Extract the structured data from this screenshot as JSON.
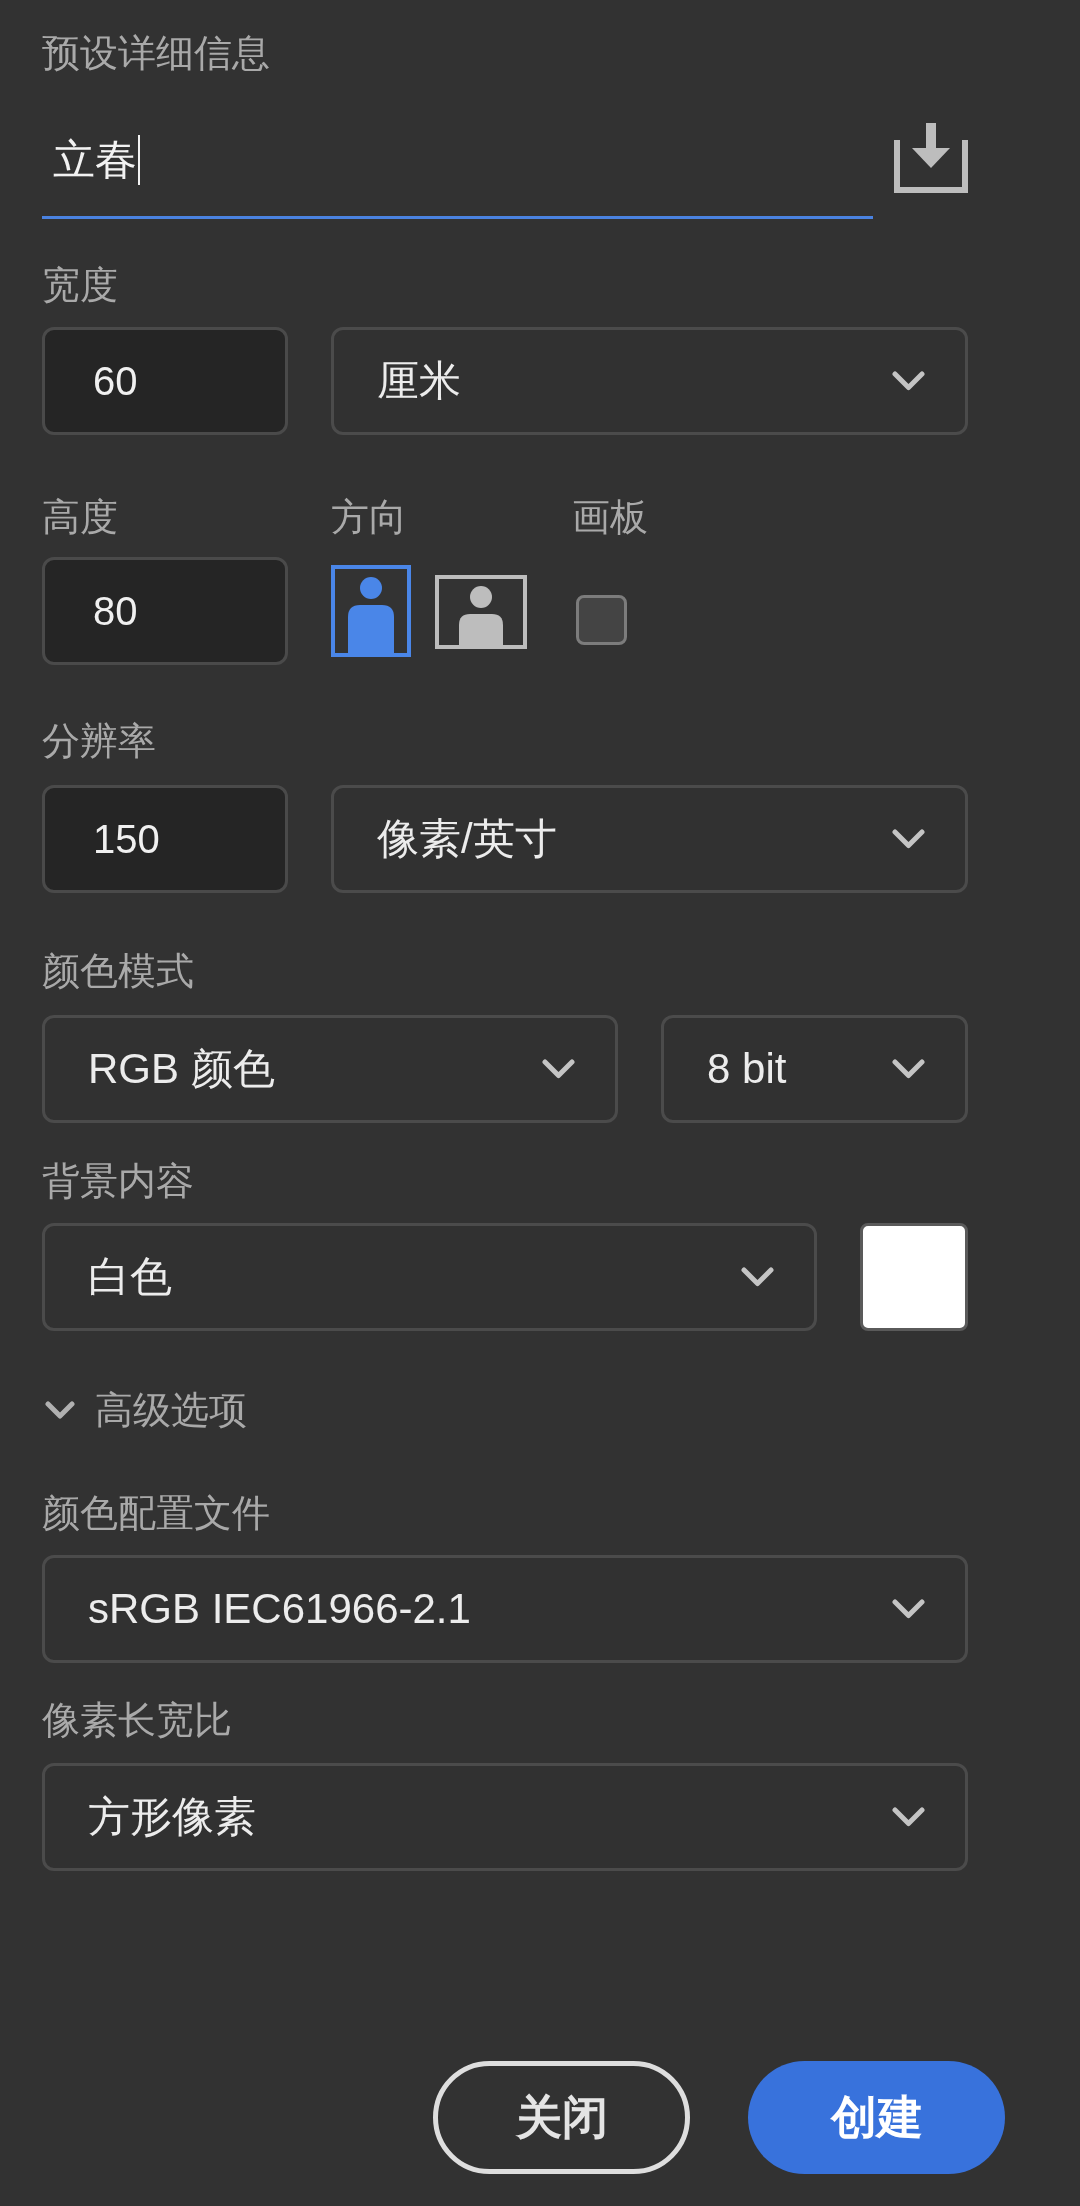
{
  "title": "预设详细信息",
  "preset_name": {
    "value": "立春",
    "focused": true
  },
  "width": {
    "label": "宽度",
    "value": "60",
    "unit": "厘米"
  },
  "height": {
    "label": "高度",
    "value": "80"
  },
  "orientation": {
    "label": "方向",
    "options": [
      {
        "kind": "portrait",
        "selected": true
      },
      {
        "kind": "landscape",
        "selected": false
      }
    ]
  },
  "artboard": {
    "label": "画板",
    "checked": false
  },
  "resolution": {
    "label": "分辨率",
    "value": "150",
    "unit": "像素/英寸"
  },
  "color_mode": {
    "label": "颜色模式",
    "mode": "RGB 颜色",
    "depth": "8 bit"
  },
  "background": {
    "label": "背景内容",
    "value": "白色",
    "color": "#ffffff"
  },
  "advanced": {
    "label": "高级选项",
    "expanded": true,
    "color_profile": {
      "label": "颜色配置文件",
      "value": "sRGB IEC61966-2.1"
    },
    "pixel_aspect": {
      "label": "像素长宽比",
      "value": "方形像素"
    }
  },
  "buttons": [
    {
      "label": "关闭",
      "kind": "secondary"
    },
    {
      "label": "创建",
      "kind": "primary"
    }
  ]
}
